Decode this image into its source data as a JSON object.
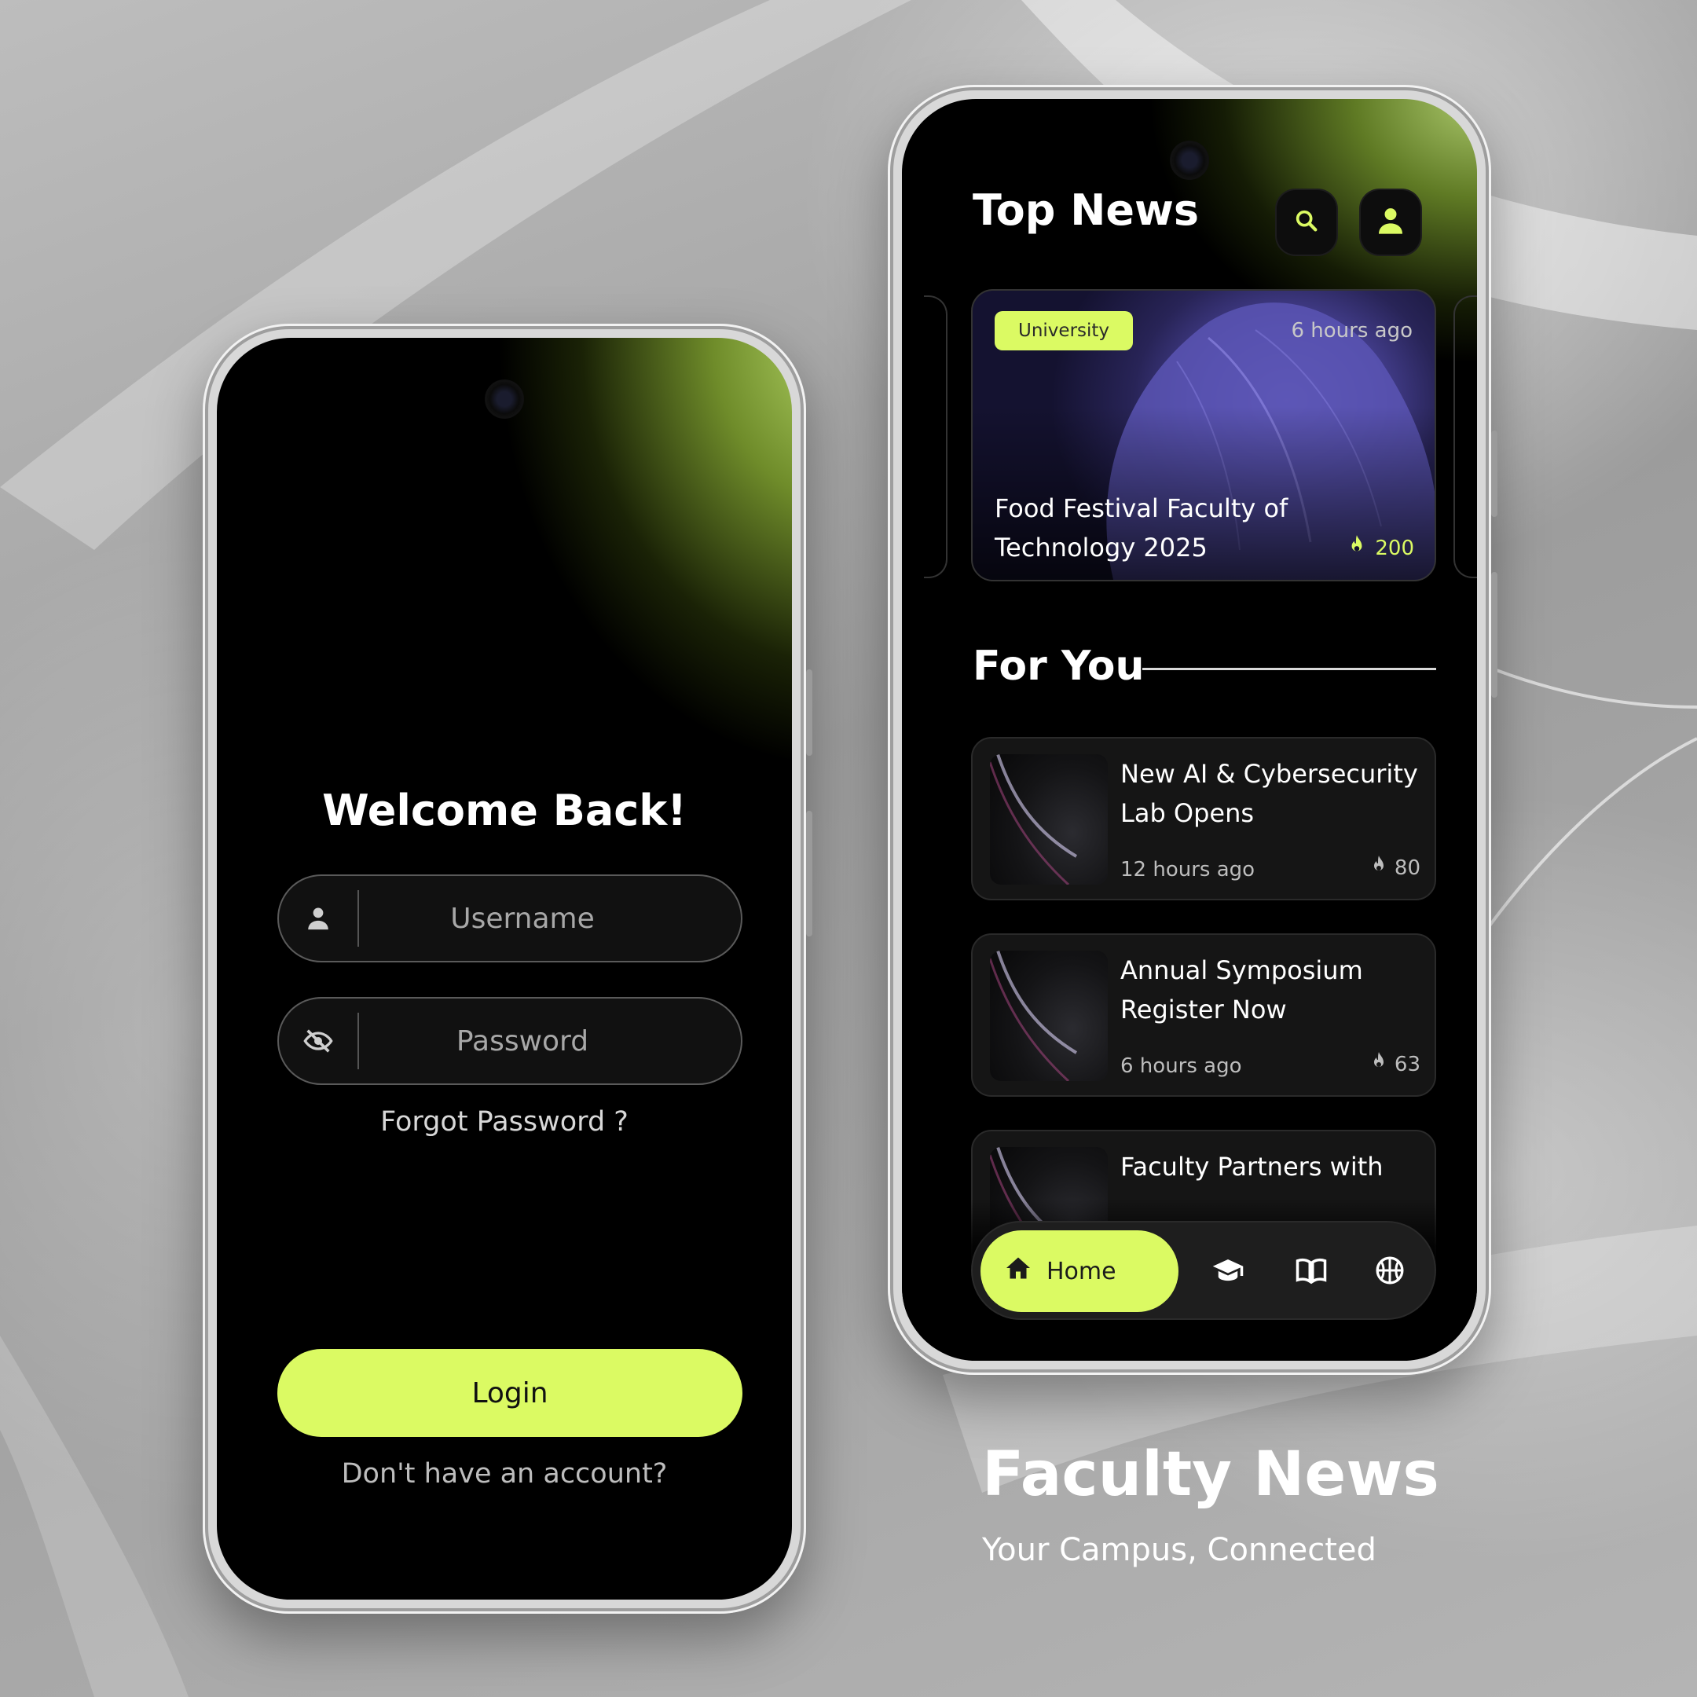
{
  "colors": {
    "accent": "#dbfa63",
    "screen_bg": "#000000",
    "card_bg": "#151515",
    "text_primary": "#ffffff",
    "text_secondary": "#bdbdbd"
  },
  "login": {
    "heading": "Welcome Back!",
    "username_placeholder": "Username",
    "password_placeholder": "Password",
    "username_icon": "user-icon",
    "password_icon": "eye-off-icon",
    "forgot_label": "Forgot Password ?",
    "login_label": "Login",
    "signup_label": "Don't have an account?"
  },
  "news": {
    "title": "Top News",
    "search_icon": "search-icon",
    "profile_icon": "user-icon",
    "featured": {
      "tag": "University",
      "time": "6 hours ago",
      "headline": "Food Festival Faculty of Technology 2025",
      "count": "200",
      "count_icon": "fire-icon"
    },
    "section_title": "For You",
    "items": [
      {
        "title": "New AI & Cybersecurity Lab Opens",
        "time": "12 hours ago",
        "count": "80"
      },
      {
        "title": "Annual Symposium Register Now",
        "time": "6 hours ago",
        "count": "63"
      },
      {
        "title": "Faculty Partners with",
        "time": "",
        "count": ""
      }
    ],
    "tabbar": {
      "home_label": "Home",
      "tabs": [
        "home-icon",
        "graduation-cap-icon",
        "book-icon",
        "basketball-icon"
      ]
    }
  },
  "brand": {
    "title": "Faculty News",
    "subtitle": "Your Campus, Connected"
  }
}
